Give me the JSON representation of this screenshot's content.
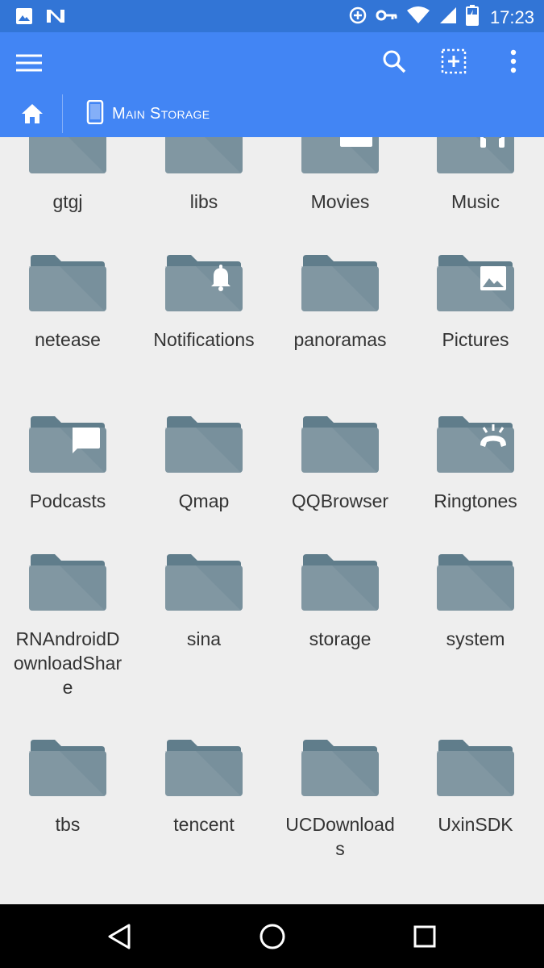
{
  "status_bar": {
    "time": "17:23",
    "icons": [
      "image-icon",
      "n-logo-icon",
      "add-circle-icon",
      "key-icon",
      "wifi-icon",
      "signal-icon",
      "battery-charging-icon"
    ]
  },
  "toolbar": {
    "menu_icon": "hamburger-icon",
    "actions": [
      "search-icon",
      "add-selection-icon",
      "more-vert-icon"
    ],
    "breadcrumb": {
      "home_icon": "home-icon",
      "device_icon": "phone-icon",
      "label": "Main Storage"
    }
  },
  "folders": [
    {
      "name": "gtgj",
      "badge": ""
    },
    {
      "name": "libs",
      "badge": ""
    },
    {
      "name": "Movies",
      "badge": "movie"
    },
    {
      "name": "Music",
      "badge": "headphones"
    },
    {
      "name": "netease",
      "badge": ""
    },
    {
      "name": "Notifications",
      "badge": "bell"
    },
    {
      "name": "panoramas",
      "badge": ""
    },
    {
      "name": "Pictures",
      "badge": "image"
    },
    {
      "name": "Podcasts",
      "badge": "chat"
    },
    {
      "name": "Qmap",
      "badge": ""
    },
    {
      "name": "QQBrowser",
      "badge": ""
    },
    {
      "name": "Ringtones",
      "badge": "ringtone"
    },
    {
      "name": "RNAndroidDownloadShare",
      "badge": ""
    },
    {
      "name": "sina",
      "badge": ""
    },
    {
      "name": "storage",
      "badge": ""
    },
    {
      "name": "system",
      "badge": ""
    },
    {
      "name": "tbs",
      "badge": ""
    },
    {
      "name": "tencent",
      "badge": ""
    },
    {
      "name": "UCDownloads",
      "badge": ""
    },
    {
      "name": "UxinSDK",
      "badge": ""
    }
  ],
  "navbar": {
    "buttons": [
      "back-icon",
      "home-circle-icon",
      "recents-icon"
    ]
  },
  "colors": {
    "status_bar": "#3275d6",
    "toolbar": "#4285f4",
    "folder_body": "#78909c",
    "folder_tab": "#607d8b",
    "background": "#eeeeee"
  }
}
